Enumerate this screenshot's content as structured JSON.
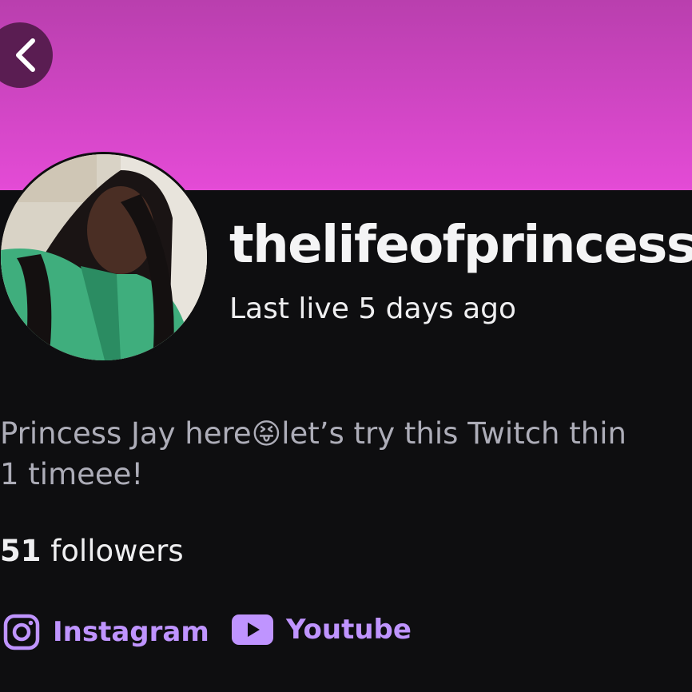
{
  "header": {
    "back_icon": "chevron-left-icon",
    "banner_color_top": "#b93fae",
    "banner_color_bottom": "#e44bd6"
  },
  "profile": {
    "username": "thelifeofprincessj",
    "last_live": "Last live 5 days ago",
    "bio_part1": "Princess Jay here",
    "bio_emoji": "😝",
    "bio_part2": "let’s try this Twitch thin",
    "bio_line2": "1 timeee!",
    "followers_count": "51",
    "followers_label": " followers"
  },
  "links": [
    {
      "label": "Instagram",
      "icon": "instagram-icon"
    },
    {
      "label": "Youtube",
      "icon": "youtube-icon"
    }
  ],
  "accent_color": "#bf94ff"
}
